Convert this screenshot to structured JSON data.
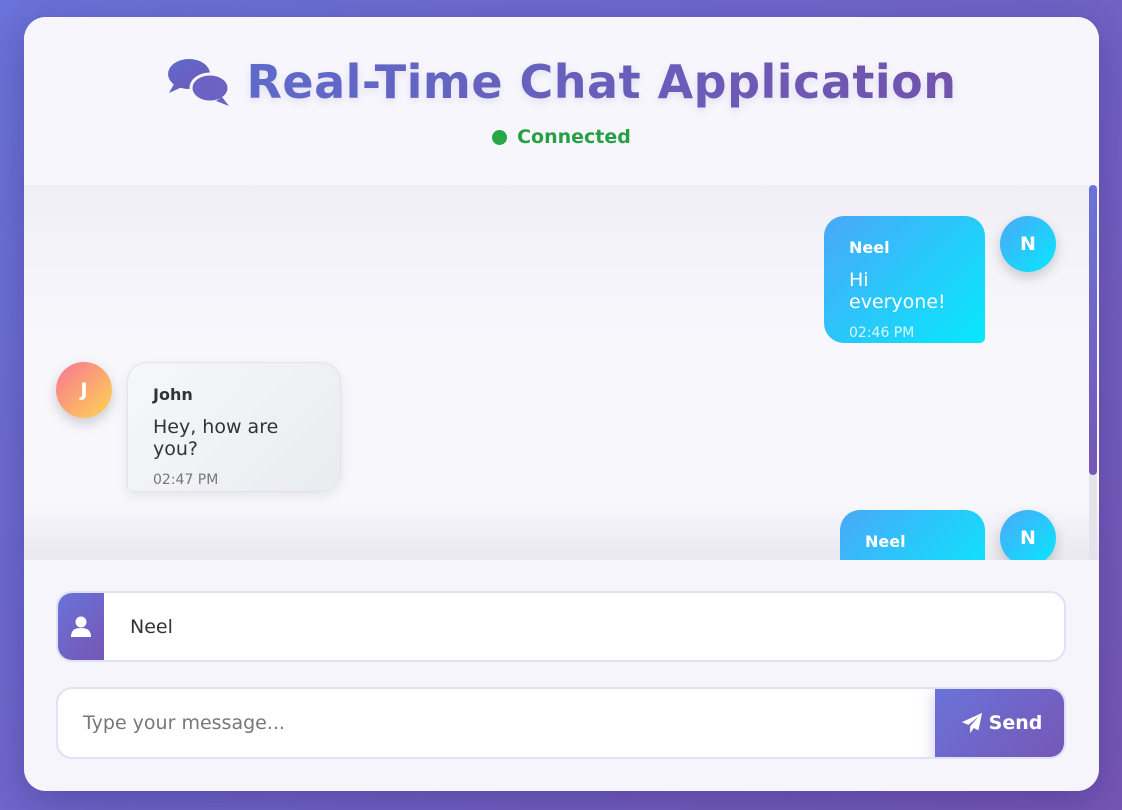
{
  "header": {
    "title": "Real-Time Chat Application",
    "title_icon": "comments-icon",
    "status": {
      "text": "Connected",
      "color": "#28a745"
    }
  },
  "messages": [
    {
      "sender": "Neel",
      "avatar_initial": "N",
      "text": "Hi everyone!",
      "time": "02:46 PM",
      "own": true
    },
    {
      "sender": "John",
      "avatar_initial": "J",
      "text": "Hey, how are you?",
      "time": "02:47 PM",
      "own": false
    },
    {
      "sender": "Neel",
      "avatar_initial": "N",
      "text": "",
      "time": "",
      "own": true
    }
  ],
  "input": {
    "username": {
      "value": "Neel",
      "icon": "user-icon"
    },
    "message": {
      "placeholder": "Type your message...",
      "value": ""
    },
    "send_button": {
      "label": "Send",
      "icon": "paper-plane-icon"
    }
  },
  "colors": {
    "accent_start": "#6a73d9",
    "accent_end": "#7656b5",
    "own_bubble_start": "#4aa8f8",
    "own_bubble_end": "#07e8fd",
    "other_avatar_start": "#f87495",
    "other_avatar_end": "#fdd752"
  }
}
